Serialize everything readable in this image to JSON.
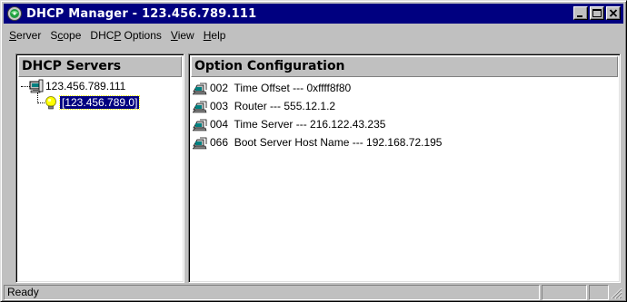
{
  "window": {
    "title": "DHCP Manager - 123.456.789.111",
    "app_icon": "dhcp-manager-icon",
    "controls": [
      "minimize",
      "maximize",
      "close"
    ]
  },
  "menu": {
    "items": [
      {
        "label": "Server",
        "underline": "S"
      },
      {
        "label": "Scope",
        "underline": "c"
      },
      {
        "label": "DHCP Options",
        "underline": "P"
      },
      {
        "label": "View",
        "underline": "V"
      },
      {
        "label": "Help",
        "underline": "H"
      }
    ]
  },
  "servers_pane": {
    "header": "DHCP Servers",
    "server": {
      "label": "123.456.789.111",
      "icon": "server-icon",
      "expander": "-"
    },
    "scope": {
      "label": "[123.456.789.0]",
      "icon": "lightbulb-icon",
      "selected": true
    }
  },
  "options_pane": {
    "header": "Option Configuration",
    "options": [
      {
        "label": "002  Time Offset --- 0xffff8f80",
        "icon": "option-icon"
      },
      {
        "label": "003  Router --- 555.12.1.2",
        "icon": "option-icon"
      },
      {
        "label": "004  Time Server --- 216.122.43.235",
        "icon": "option-icon"
      },
      {
        "label": "066  Boot Server Host Name --- 192.168.72.195",
        "icon": "option-icon"
      }
    ]
  },
  "statusbar": {
    "text": "Ready"
  },
  "colors": {
    "titlebar": "#000080",
    "face": "#c0c0c0",
    "selection": "#000080"
  }
}
